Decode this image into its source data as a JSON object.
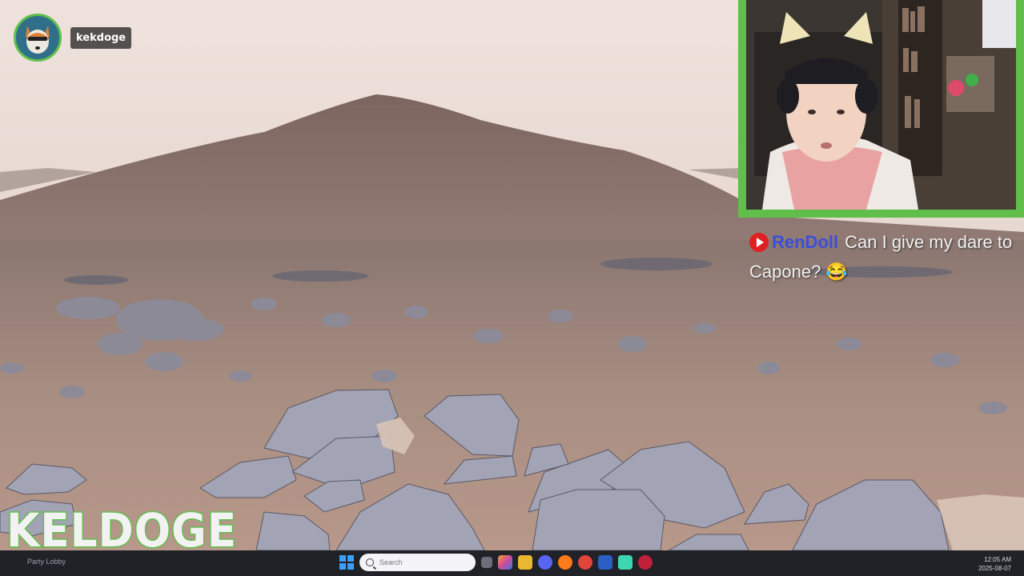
{
  "overlay": {
    "username": "kekdoge",
    "brand": "KELDOGE"
  },
  "chat": {
    "platform_icon": "youtube-icon",
    "author": "RenDoll",
    "message": "Can I give my dare to Capone? 😂"
  },
  "taskbar": {
    "left_text": "Party Lobby",
    "search_placeholder": "Search",
    "time": "12:05 AM",
    "date": "2025-08-07"
  },
  "colors": {
    "accent_green": "#5fbf4a",
    "chat_author": "#3b4fd8",
    "taskbar": "#202228"
  }
}
